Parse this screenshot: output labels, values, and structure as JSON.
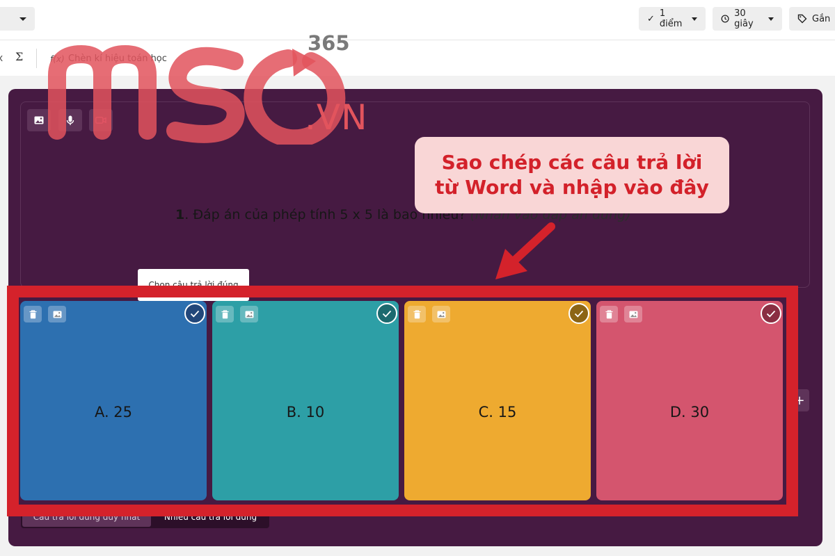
{
  "header": {
    "points_label": "1 điểm",
    "time_label": "30 giây",
    "tag_label": "Gắn"
  },
  "toolbar": {
    "fx_label": "f(x)",
    "math_label": "Chèn kí hiệu toán học",
    "sigma_label": "Σ"
  },
  "question": {
    "number": "1",
    "text": ". Đáp án của phép tính 5 x 5 là bao nhiêu?",
    "hint": "(Nhấn vào đáp án đúng)"
  },
  "tooltip": {
    "text": "Chọn câu trả lời đúng"
  },
  "answers": [
    {
      "label": "A. 25",
      "color": "#2d70b0"
    },
    {
      "label": "B. 10",
      "color": "#2d9fa6"
    },
    {
      "label": "C. 15",
      "color": "#eeaa30"
    },
    {
      "label": "D. 30",
      "color": "#d4556e"
    }
  ],
  "answer_mode": {
    "single": "Câu trả lời đúng duy nhất",
    "multiple": "Nhiều câu trả lời đúng"
  },
  "add_button": "+",
  "callout": {
    "line1": "Sao chép các câu trả lời",
    "line2": "từ Word và nhập vào đây"
  },
  "watermark": {
    "brand": "MSO",
    "suffix": ".VN",
    "sub": "365"
  },
  "colors": {
    "panel": "#461a42",
    "highlight": "#d4222b",
    "callout_bg": "#f9d6d6",
    "callout_text": "#d3212a"
  }
}
